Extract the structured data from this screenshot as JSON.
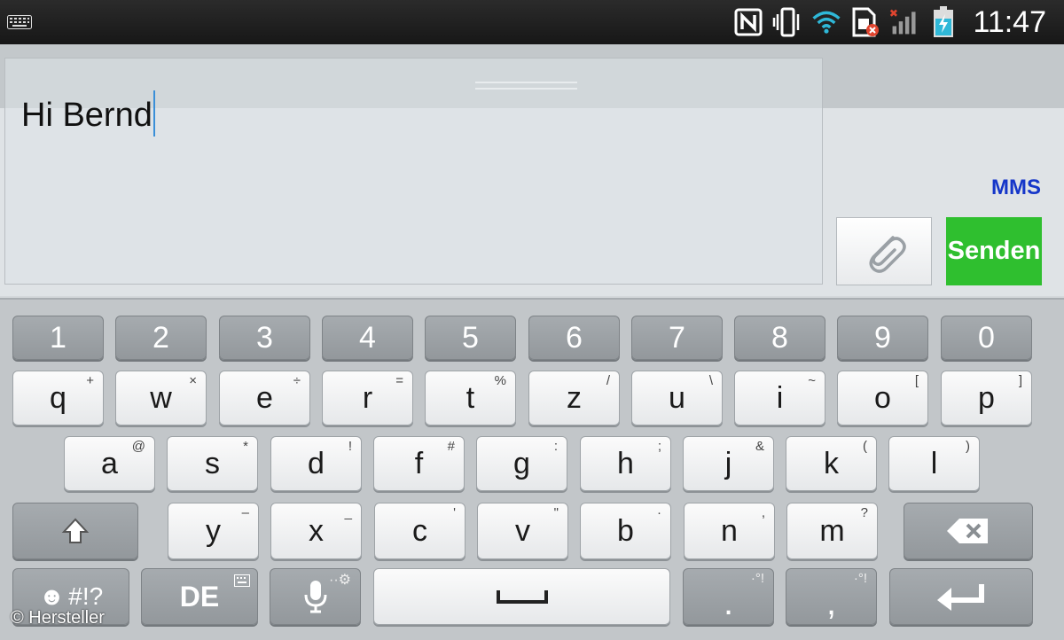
{
  "status_bar": {
    "time": "11:47",
    "icons": [
      "keyboard-icon",
      "nfc-icon",
      "vibrate-icon",
      "wifi-icon",
      "sim-error-icon",
      "signal-icon",
      "battery-charging-icon"
    ]
  },
  "compose": {
    "message_text": "Hi Bernd",
    "mms_label": "MMS",
    "send_label": "Senden",
    "attach_icon": "paperclip-icon"
  },
  "keyboard": {
    "rows": [
      [
        {
          "main": "1",
          "sec": ""
        },
        {
          "main": "2",
          "sec": ""
        },
        {
          "main": "3",
          "sec": ""
        },
        {
          "main": "4",
          "sec": ""
        },
        {
          "main": "5",
          "sec": ""
        },
        {
          "main": "6",
          "sec": ""
        },
        {
          "main": "7",
          "sec": ""
        },
        {
          "main": "8",
          "sec": ""
        },
        {
          "main": "9",
          "sec": ""
        },
        {
          "main": "0",
          "sec": ""
        }
      ],
      [
        {
          "main": "q",
          "sec": "+"
        },
        {
          "main": "w",
          "sec": "×"
        },
        {
          "main": "e",
          "sec": "÷"
        },
        {
          "main": "r",
          "sec": "="
        },
        {
          "main": "t",
          "sec": "%"
        },
        {
          "main": "z",
          "sec": "/"
        },
        {
          "main": "u",
          "sec": "\\"
        },
        {
          "main": "i",
          "sec": "~"
        },
        {
          "main": "o",
          "sec": "["
        },
        {
          "main": "p",
          "sec": "]"
        }
      ],
      [
        {
          "main": "a",
          "sec": "@"
        },
        {
          "main": "s",
          "sec": "*"
        },
        {
          "main": "d",
          "sec": "!"
        },
        {
          "main": "f",
          "sec": "#"
        },
        {
          "main": "g",
          "sec": ":"
        },
        {
          "main": "h",
          "sec": ";"
        },
        {
          "main": "j",
          "sec": "&"
        },
        {
          "main": "k",
          "sec": "("
        },
        {
          "main": "l",
          "sec": ")"
        }
      ],
      [
        {
          "main": "y",
          "sec": "–"
        },
        {
          "main": "x",
          "sec": "_"
        },
        {
          "main": "c",
          "sec": "'"
        },
        {
          "main": "v",
          "sec": "\""
        },
        {
          "main": "b",
          "sec": "·"
        },
        {
          "main": "n",
          "sec": ","
        },
        {
          "main": "m",
          "sec": "?"
        }
      ]
    ],
    "symbols_label": "#!?",
    "language_label": "DE",
    "period_label": ".",
    "period_sec": "·°!",
    "comma_label": ",",
    "comma_sec": "·°!"
  },
  "watermark": "© Hersteller"
}
